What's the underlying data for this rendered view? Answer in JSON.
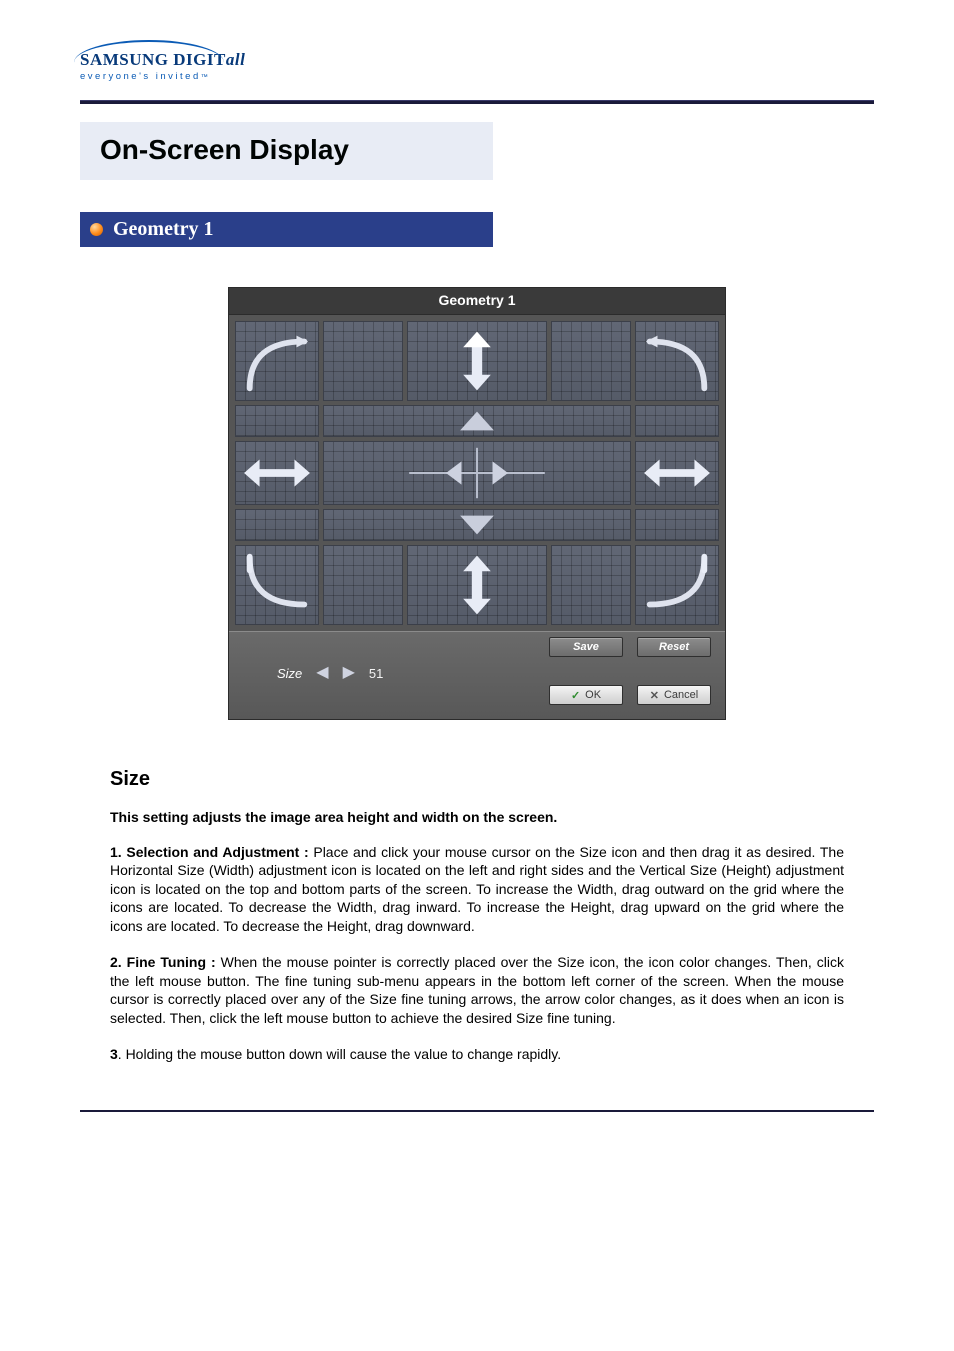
{
  "logo": {
    "brand_prefix": "SAMSUNG DIGIT",
    "brand_suffix": "all",
    "tagline": "everyone's invited",
    "tm": "™"
  },
  "page_title": "On-Screen Display",
  "section_title": "Geometry 1",
  "osd": {
    "title": "Geometry 1",
    "param_label": "Size",
    "param_value": "51",
    "save": "Save",
    "reset": "Reset",
    "ok": "OK",
    "cancel": "Cancel"
  },
  "content": {
    "heading": "Size",
    "lead": "This setting adjusts the image area height and width on the screen.",
    "p1_label": "1. Selection and Adjustment :",
    "p1_body": " Place and click your mouse cursor on the Size icon and then drag it as desired. The Horizontal Size (Width) adjustment icon is located on the left and right sides and the Vertical Size (Height) adjustment icon is located on the top and bottom parts of the screen. To increase the Width, drag outward on the grid where the icons are located. To decrease the Width, drag inward. To increase the Height, drag upward on the grid where the icons are located. To decrease the Height, drag downward.",
    "p2_label": "2. Fine Tuning :",
    "p2_body": " When the mouse pointer is correctly placed over the Size icon, the icon color changes. Then, click the left mouse button. The fine tuning sub-menu appears in the bottom left corner of the screen. When the mouse cursor is correctly placed over any of the Size fine tuning arrows, the arrow color changes, as it does when an icon is selected. Then, click the left mouse button to achieve the desired Size fine tuning.",
    "p3_label": "3",
    "p3_body": ". Holding the mouse button down will cause the value to change rapidly."
  }
}
